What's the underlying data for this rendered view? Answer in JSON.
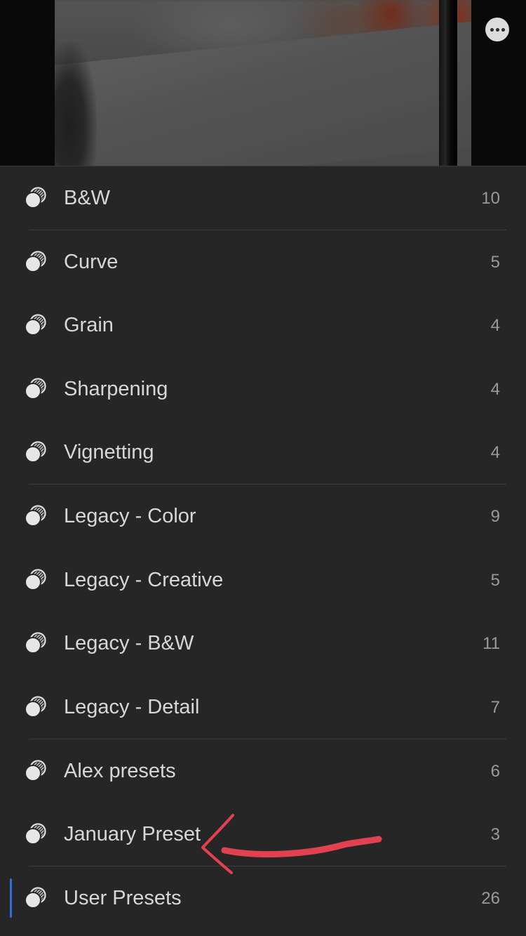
{
  "header": {
    "more_icon": "more-horizontal-icon"
  },
  "presets": [
    {
      "label": "B&W",
      "count": "10",
      "icon": "preset-group-icon"
    },
    {
      "label": "Curve",
      "count": "5",
      "icon": "preset-group-icon"
    },
    {
      "label": "Grain",
      "count": "4",
      "icon": "preset-group-icon"
    },
    {
      "label": "Sharpening",
      "count": "4",
      "icon": "preset-group-icon"
    },
    {
      "label": "Vignetting",
      "count": "4",
      "icon": "preset-group-icon"
    },
    {
      "label": "Legacy - Color",
      "count": "9",
      "icon": "preset-group-icon"
    },
    {
      "label": "Legacy - Creative",
      "count": "5",
      "icon": "preset-group-icon"
    },
    {
      "label": "Legacy - B&W",
      "count": "11",
      "icon": "preset-group-icon"
    },
    {
      "label": "Legacy - Detail",
      "count": "7",
      "icon": "preset-group-icon"
    },
    {
      "label": "Alex presets",
      "count": "6",
      "icon": "preset-group-icon"
    },
    {
      "label": "January Preset",
      "count": "3",
      "icon": "preset-group-icon"
    },
    {
      "label": "User Presets",
      "count": "26",
      "icon": "preset-group-icon",
      "selected": true
    }
  ],
  "colors": {
    "panel_background": "#262626",
    "text": "#d7d7d7",
    "count_text": "#9a9a9a",
    "selection_accent": "#2f6ee0",
    "annotation_arrow": "#e2424f"
  }
}
